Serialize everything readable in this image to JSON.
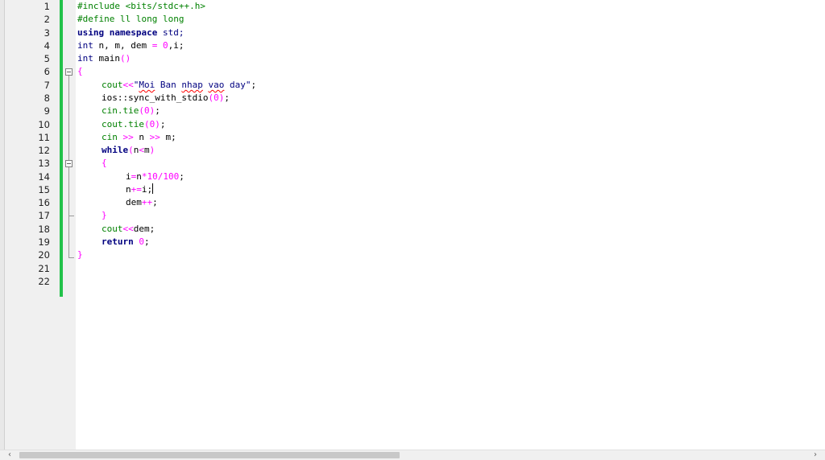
{
  "editor": {
    "line_numbers": [
      "1",
      "2",
      "3",
      "4",
      "5",
      "6",
      "7",
      "8",
      "9",
      "10",
      "11",
      "12",
      "13",
      "14",
      "15",
      "16",
      "17",
      "18",
      "19",
      "20",
      "21",
      "22"
    ],
    "code": {
      "l1": "#include <bits/stdc++.h>",
      "l2": "#define ll long long",
      "l3_kw": "using namespace",
      "l3_rest": " std;",
      "l4_kw": "int",
      "l4_a": " n, m, dem ",
      "l4_eq": "=",
      "l4_sp": " ",
      "l4_zero": "0",
      "l4_b": ",i;",
      "l5_kw": "int",
      "l5_a": " main",
      "l5_p": "()",
      "l6": "{",
      "l7_id": "cout",
      "l7_op": "<<",
      "l7_s1": "\"",
      "l7_moi": "Moi",
      "l7_s2": " Ban ",
      "l7_nhap": "nhap",
      "l7_s3": " ",
      "l7_vao": "vao",
      "l7_s4": " day\"",
      "l7_end": ";",
      "l8_a": "ios::sync_with_stdio",
      "l8_p": "(0)",
      "l8_end": ";",
      "l9_a": "cin.tie",
      "l9_p": "(0)",
      "l9_end": ";",
      "l10_a": "cout.tie",
      "l10_p": "(0)",
      "l10_end": ";",
      "l11_a": "cin ",
      "l11_op1": ">>",
      "l11_b": " n ",
      "l11_op2": ">>",
      "l11_c": " m;",
      "l12_kw": "while",
      "l12_p1": "(",
      "l12_a": "n",
      "l12_op": "<",
      "l12_b": "m",
      "l12_p2": ")",
      "l13": "{",
      "l14_a": "i",
      "l14_op1": "=",
      "l14_b": "n",
      "l14_op2": "*",
      "l14_n1": "10",
      "l14_op3": "/",
      "l14_n2": "100",
      "l14_end": ";",
      "l15_a": "n",
      "l15_op": "+=",
      "l15_b": "i;",
      "l16_a": "dem",
      "l16_op": "++",
      "l16_end": ";",
      "l17": "}",
      "l18_a": "cout",
      "l18_op": "<<",
      "l18_b": "dem;",
      "l19_kw": "return",
      "l19_sp": " ",
      "l19_n": "0",
      "l19_end": ";",
      "l20": "}"
    }
  },
  "colors": {
    "keyword": "#000080",
    "preprocessor": "#008000",
    "operator_number": "#ff00ff",
    "change_bar": "#22c24a"
  },
  "scrollbar": {
    "left_arrow": "‹",
    "right_arrow": "›"
  }
}
